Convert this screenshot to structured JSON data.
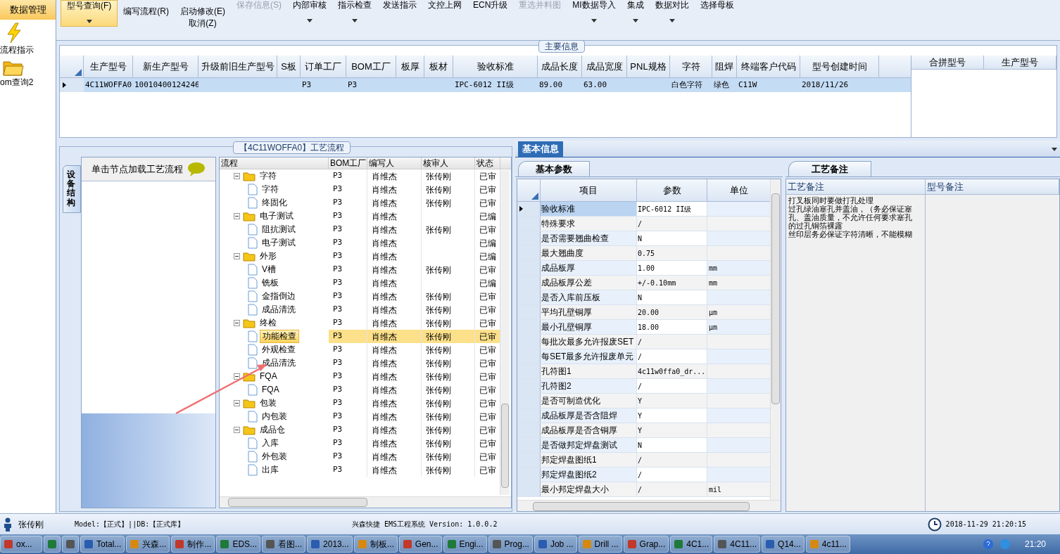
{
  "sidebar": {
    "header": "数据管理",
    "items": [
      {
        "label": "流程指示",
        "kind": "lightning"
      },
      {
        "label": "om查询2",
        "kind": "folder"
      }
    ]
  },
  "toolbar": [
    {
      "label": "型号查询(F)",
      "selected": true,
      "disabled": false,
      "menu": true
    },
    {
      "label": "编写流程(R)",
      "selected": false,
      "disabled": false,
      "menu": false
    },
    {
      "label": "启动修改(E)",
      "sub": "取消(Z)",
      "selected": false,
      "disabled": false,
      "menu": false
    },
    {
      "label": "保存信息(S)",
      "selected": false,
      "disabled": true,
      "menu": false
    },
    {
      "label": "内部审核",
      "selected": false,
      "disabled": false,
      "menu": true
    },
    {
      "label": "指示检查",
      "selected": false,
      "disabled": false,
      "menu": true
    },
    {
      "label": "发送指示",
      "selected": false,
      "disabled": false,
      "menu": false
    },
    {
      "label": "文控上网",
      "selected": false,
      "disabled": false,
      "menu": false
    },
    {
      "label": "ECN升级",
      "selected": false,
      "disabled": false,
      "menu": false
    },
    {
      "label": "重选并料图",
      "selected": false,
      "disabled": true,
      "menu": false
    },
    {
      "label": "MI数据导入",
      "selected": false,
      "disabled": false,
      "menu": true
    },
    {
      "label": "集成",
      "selected": false,
      "disabled": false,
      "menu": true
    },
    {
      "label": "数据对比",
      "selected": false,
      "disabled": false,
      "menu": true
    },
    {
      "label": "选择母板",
      "selected": false,
      "disabled": false,
      "menu": false
    }
  ],
  "main_info": {
    "title": "主要信息",
    "columns": [
      "生产型号",
      "新生产型号",
      "升级前旧生产型号",
      "S板",
      "订单工厂",
      "BOM工厂",
      "板厚",
      "板材",
      "验收标准",
      "成品长度",
      "成品宽度",
      "PNL规格",
      "字符",
      "阻焊",
      "终端客户代码",
      "型号创建时间"
    ],
    "rows": [
      {
        "selected": true,
        "cells": [
          "4C11WOFFA0",
          "10010400124246",
          null,
          null,
          "P3",
          "P3",
          null,
          null,
          "IPC-6012 II级",
          "89.00",
          "63.00",
          null,
          "白色字符",
          "绿色",
          "C11W",
          "2018/11/26"
        ]
      }
    ],
    "merge_columns": [
      "合拼型号",
      "生产型号"
    ]
  },
  "flow": {
    "title": "【4C11WOFFA0】工艺流程",
    "side_tab": "设备结构",
    "hint": "单击节点加载工艺流程",
    "columns": [
      "流程",
      "BOM工厂",
      "编写人",
      "核审人",
      "状态"
    ],
    "tree": [
      {
        "label": "字符",
        "kind": "folder",
        "bom": "P3",
        "author": "肖维杰",
        "reviewer": "张传刚",
        "status": "已审",
        "selected": false,
        "children": [
          {
            "label": "字符",
            "kind": "step",
            "bom": "P3",
            "author": "肖维杰",
            "reviewer": "张传刚",
            "status": "已审",
            "selected": false
          },
          {
            "label": "终固化",
            "kind": "step",
            "bom": "P3",
            "author": "肖维杰",
            "reviewer": "张传刚",
            "status": "已审",
            "selected": false
          }
        ]
      },
      {
        "label": "电子测试",
        "kind": "folder",
        "bom": "P3",
        "author": "肖维杰",
        "status": "已编",
        "selected": false,
        "children": [
          {
            "label": "阻抗测试",
            "kind": "step",
            "bom": "P3",
            "author": "肖维杰",
            "reviewer": "张传刚",
            "status": "已审",
            "selected": false
          },
          {
            "label": "电子测试",
            "kind": "step",
            "bom": "P3",
            "author": "肖维杰",
            "status": "已编",
            "selected": false
          }
        ]
      },
      {
        "label": "外形",
        "kind": "folder",
        "bom": "P3",
        "author": "肖维杰",
        "status": "已编",
        "selected": false,
        "children": [
          {
            "label": "V槽",
            "kind": "step",
            "bom": "P3",
            "author": "肖维杰",
            "reviewer": "张传刚",
            "status": "已审",
            "selected": false
          },
          {
            "label": "铣板",
            "kind": "step",
            "bom": "P3",
            "author": "肖维杰",
            "status": "已编",
            "selected": false
          },
          {
            "label": "金指倒边",
            "kind": "step",
            "bom": "P3",
            "author": "肖维杰",
            "reviewer": "张传刚",
            "status": "已审",
            "selected": false
          },
          {
            "label": "成品清洗",
            "kind": "step",
            "bom": "P3",
            "author": "肖维杰",
            "reviewer": "张传刚",
            "status": "已审",
            "selected": false
          }
        ]
      },
      {
        "label": "终检",
        "kind": "folder",
        "bom": "P3",
        "author": "肖维杰",
        "reviewer": "张传刚",
        "status": "已审",
        "selected": false,
        "children": [
          {
            "label": "功能检查",
            "kind": "step",
            "bom": "P3",
            "author": "肖维杰",
            "reviewer": "张传刚",
            "status": "已审",
            "selected": true
          },
          {
            "label": "外观检查",
            "kind": "step",
            "bom": "P3",
            "author": "肖维杰",
            "reviewer": "张传刚",
            "status": "已审",
            "selected": false
          },
          {
            "label": "成品清洗",
            "kind": "step",
            "bom": "P3",
            "author": "肖维杰",
            "reviewer": "张传刚",
            "status": "已审",
            "selected": false
          }
        ]
      },
      {
        "label": "FQA",
        "kind": "folder",
        "bom": "P3",
        "author": "肖维杰",
        "reviewer": "张传刚",
        "status": "已审",
        "selected": false,
        "children": [
          {
            "label": "FQA",
            "kind": "step",
            "bom": "P3",
            "author": "肖维杰",
            "reviewer": "张传刚",
            "status": "已审",
            "selected": false
          }
        ]
      },
      {
        "label": "包装",
        "kind": "folder",
        "bom": "P3",
        "author": "肖维杰",
        "reviewer": "张传刚",
        "status": "已审",
        "selected": false,
        "children": [
          {
            "label": "内包装",
            "kind": "step",
            "bom": "P3",
            "author": "肖维杰",
            "reviewer": "张传刚",
            "status": "已审",
            "selected": false
          }
        ]
      },
      {
        "label": "成品仓",
        "kind": "folder",
        "bom": "P3",
        "author": "肖维杰",
        "reviewer": "张传刚",
        "status": "已审",
        "selected": false,
        "children": [
          {
            "label": "入库",
            "kind": "step",
            "bom": "P3",
            "author": "肖维杰",
            "reviewer": "张传刚",
            "status": "已审",
            "selected": false
          },
          {
            "label": "外包装",
            "kind": "step",
            "bom": "P3",
            "author": "肖维杰",
            "reviewer": "张传刚",
            "status": "已审",
            "selected": false
          },
          {
            "label": "出库",
            "kind": "step",
            "bom": "P3",
            "author": "肖维杰",
            "reviewer": "张传刚",
            "status": "已审",
            "selected": false
          }
        ]
      }
    ]
  },
  "basic_info": {
    "title": "基本信息",
    "params_tab": "基本参数",
    "columns": [
      "项目",
      "参数",
      "单位"
    ],
    "params": [
      {
        "item": "验收标准",
        "value": "IPC-6012 II级",
        "selected": true
      },
      {
        "item": "特殊要求",
        "value": "/",
        "selected": false
      },
      {
        "item": "是否需要翘曲检查",
        "value": "N",
        "selected": false
      },
      {
        "item": "最大翘曲度",
        "value": "0.75",
        "selected": false
      },
      {
        "item": "成品板厚",
        "value": "1.00",
        "unit": "mm",
        "selected": false
      },
      {
        "item": "成品板厚公差",
        "value": "+/-0.10mm",
        "unit": "mm",
        "selected": false
      },
      {
        "item": "是否入库前压板",
        "value": "N",
        "selected": false
      },
      {
        "item": "平均孔壁铜厚",
        "value": "20.00",
        "unit": "μm",
        "selected": false
      },
      {
        "item": "最小孔壁铜厚",
        "value": "18.00",
        "unit": "μm",
        "selected": false
      },
      {
        "item": "每批次最多允许报废SET",
        "value": "/",
        "selected": false
      },
      {
        "item": "每SET最多允许报废单元",
        "value": "/",
        "selected": false
      },
      {
        "item": "孔符图1",
        "value": "4c11w0ffa0_dr...",
        "selected": false
      },
      {
        "item": "孔符图2",
        "value": "/",
        "selected": false
      },
      {
        "item": "是否可制造优化",
        "value": "Y",
        "selected": false
      },
      {
        "item": "成品板厚是否含阻焊",
        "value": "Y",
        "selected": false
      },
      {
        "item": "成品板厚是否含铜厚",
        "value": "Y",
        "selected": false
      },
      {
        "item": "是否做邦定焊盘测试",
        "value": "N",
        "selected": false
      },
      {
        "item": "邦定焊盘图纸1",
        "value": "/",
        "selected": false
      },
      {
        "item": "邦定焊盘图纸2",
        "value": "/",
        "selected": false
      },
      {
        "item": "最小邦定焊盘大小",
        "value": "/",
        "unit": "mil",
        "selected": false
      }
    ],
    "notes_tab": "工艺备注",
    "notes_columns": [
      "工艺备注",
      "型号备注"
    ],
    "process_note": [
      "打叉板同时要做打孔处理",
      "过孔绿油塞孔并盖油，（务必保证塞孔、盖油质量，不允许任何要求塞孔的过孔铜箔裸露",
      "丝印层务必保证字符清晰，不能模糊"
    ]
  },
  "status_bar": {
    "user": "张传刚",
    "model": "Model:【正式】||DB:【正式库】",
    "app": "兴森快捷 EMS工程系统 Version: 1.0.0.2",
    "datetime": "2018-11-29 21:20:15"
  },
  "taskbar": {
    "items": [
      {
        "kind": "app",
        "label": "ox..."
      },
      {
        "kind": "icon"
      },
      {
        "kind": "icon"
      },
      {
        "kind": "app",
        "label": "Total..."
      },
      {
        "kind": "app",
        "label": "兴森..."
      },
      {
        "kind": "app",
        "label": "制作..."
      },
      {
        "kind": "app",
        "label": "EDS..."
      },
      {
        "kind": "app",
        "label": "看图..."
      },
      {
        "kind": "app",
        "label": "2013..."
      },
      {
        "kind": "app",
        "label": "制板..."
      },
      {
        "kind": "app",
        "label": "Gen..."
      },
      {
        "kind": "app",
        "label": "Engi..."
      },
      {
        "kind": "app",
        "label": "Prog..."
      },
      {
        "kind": "app",
        "label": "Job ..."
      },
      {
        "kind": "app",
        "label": "Drill ..."
      },
      {
        "kind": "app",
        "label": "Grap..."
      },
      {
        "kind": "app",
        "label": "4C1..."
      },
      {
        "kind": "app",
        "label": "4C11..."
      },
      {
        "kind": "app",
        "label": "Q14..."
      },
      {
        "kind": "app",
        "label": "4c11..."
      }
    ],
    "time": "21:20"
  }
}
